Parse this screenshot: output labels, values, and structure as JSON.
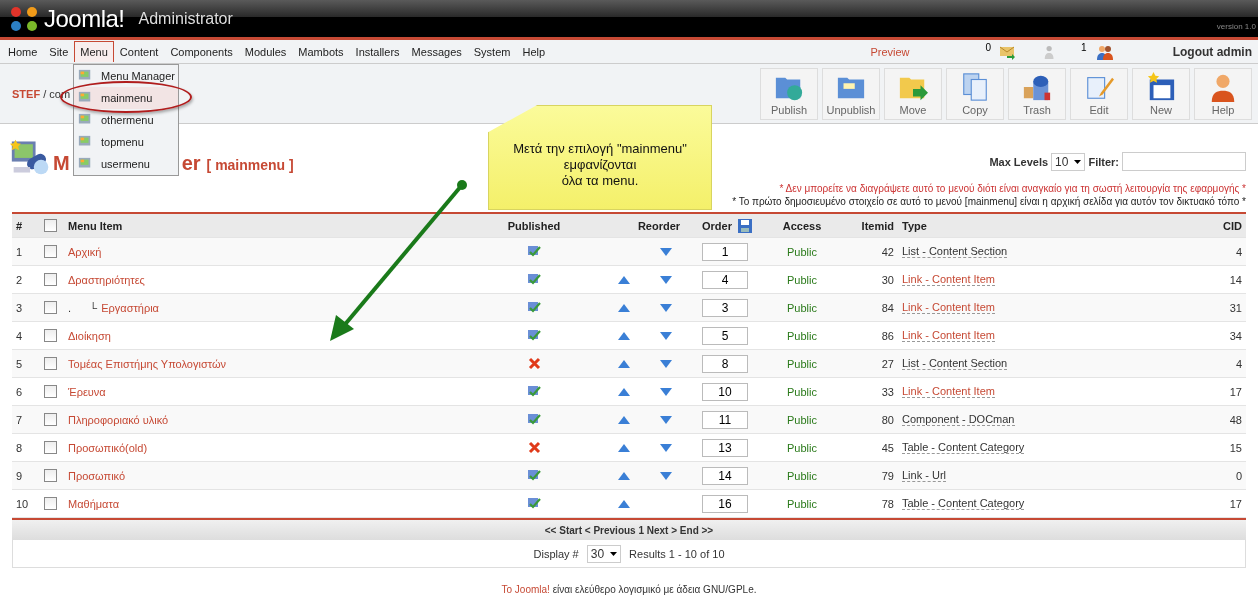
{
  "header": {
    "logo_text": "Joomla!",
    "subtitle": "Administrator",
    "version": "version 1.0"
  },
  "nav": {
    "items": [
      {
        "label": "Home",
        "selected": false
      },
      {
        "label": "Site",
        "selected": false
      },
      {
        "label": "Menu",
        "selected": true
      },
      {
        "label": "Content",
        "selected": false
      },
      {
        "label": "Components",
        "selected": false
      },
      {
        "label": "Modules",
        "selected": false
      },
      {
        "label": "Mambots",
        "selected": false
      },
      {
        "label": "Installers",
        "selected": false
      },
      {
        "label": "Messages",
        "selected": false
      },
      {
        "label": "System",
        "selected": false
      },
      {
        "label": "Help",
        "selected": false
      }
    ],
    "preview": "Preview",
    "messages_count": "0",
    "online_count": "1",
    "logout": "Logout admin"
  },
  "dropdown": {
    "items": [
      {
        "label": "Menu Manager",
        "selected": false
      },
      {
        "label": "mainmenu",
        "selected": true
      },
      {
        "label": "othermenu",
        "selected": false
      },
      {
        "label": "topmenu",
        "selected": false
      },
      {
        "label": "usermenu",
        "selected": false
      }
    ]
  },
  "breadcrumb": {
    "site": "STEF",
    "path": "/ com"
  },
  "toolbar": {
    "buttons": [
      {
        "label": "Publish",
        "kind": "publish"
      },
      {
        "label": "Unpublish",
        "kind": "unpublish"
      },
      {
        "label": "Move",
        "kind": "move"
      },
      {
        "label": "Copy",
        "kind": "copy"
      },
      {
        "label": "Trash",
        "kind": "trash"
      },
      {
        "label": "Edit",
        "kind": "edit"
      },
      {
        "label": "New",
        "kind": "new"
      },
      {
        "label": "Help",
        "kind": "help"
      }
    ]
  },
  "callout": {
    "lines": [
      "Μετά την επιλογή \"mainmenu\"",
      "εμφανίζονται",
      "όλα τα menu."
    ]
  },
  "page_title": {
    "start": "M",
    "end": "er",
    "menu_name": "[ mainmenu ]"
  },
  "filter": {
    "max_levels_label": "Max Levels",
    "max_levels": "10",
    "filter_label": "Filter:"
  },
  "notices": [
    {
      "text": "* Δεν μπορείτε να διαγράψετε αυτό το μενού διότι είναι αναγκαίο για τη σωστή λειτουργία της εφαρμογής *",
      "kind": "warning"
    },
    {
      "text": "* Το πρώτο δημοσιευμένο στοιχείο σε αυτό το μενού [mainmenu] είναι η αρχική σελίδα για αυτόν τον δικτυακό τόπο *",
      "kind": "info"
    }
  ],
  "table": {
    "select_all_checked": false,
    "columns": [
      "#",
      "Menu Item",
      "Published",
      "Reorder",
      "Order",
      "Access",
      "Itemid",
      "Type",
      "CID"
    ],
    "rows": [
      {
        "num": "1",
        "name": "Αρχική",
        "checked": false,
        "published": true,
        "can_up": false,
        "can_down": true,
        "order": "1",
        "access": "Public",
        "itemid": "42",
        "type": "List - Content Section",
        "type_link": false,
        "cid": "4"
      },
      {
        "num": "2",
        "name": "Δραστηριότητες",
        "checked": false,
        "published": true,
        "can_up": true,
        "can_down": true,
        "order": "4",
        "access": "Public",
        "itemid": "30",
        "type": "Link - Content Item",
        "type_link": true,
        "cid": "14",
        "children": [
          {
            "num": "3",
            "prefix": ".      └",
            "name": "Εργαστήρια",
            "checked": false,
            "published": true,
            "can_up": true,
            "can_down": true,
            "order": "3",
            "access": "Public",
            "itemid": "84",
            "type": "Link - Content Item",
            "type_link": true,
            "cid": "31"
          }
        ]
      },
      {
        "num": "4",
        "name": "Διοίκηση",
        "checked": false,
        "published": true,
        "can_up": true,
        "can_down": true,
        "order": "5",
        "access": "Public",
        "itemid": "86",
        "type": "Link - Content Item",
        "type_link": true,
        "cid": "34"
      },
      {
        "num": "5",
        "name": "Τομέας Επιστήμης Υπολογιστών",
        "checked": false,
        "published": false,
        "can_up": true,
        "can_down": true,
        "order": "8",
        "access": "Public",
        "itemid": "27",
        "type": "List - Content Section",
        "type_link": false,
        "cid": "4"
      },
      {
        "num": "6",
        "name": "Έρευνα",
        "checked": false,
        "published": true,
        "can_up": true,
        "can_down": true,
        "order": "10",
        "access": "Public",
        "itemid": "33",
        "type": "Link - Content Item",
        "type_link": true,
        "cid": "17"
      },
      {
        "num": "7",
        "name": "Πληροφοριακό υλικό",
        "checked": false,
        "published": true,
        "can_up": true,
        "can_down": true,
        "order": "11",
        "access": "Public",
        "itemid": "80",
        "type": "Component - DOCman",
        "type_link": false,
        "cid": "48"
      },
      {
        "num": "8",
        "name": "Προσωπικό(old)",
        "checked": false,
        "published": false,
        "can_up": true,
        "can_down": true,
        "order": "13",
        "access": "Public",
        "itemid": "45",
        "type": "Table - Content Category",
        "type_link": false,
        "cid": "15"
      },
      {
        "num": "9",
        "name": "Προσωπικό",
        "checked": false,
        "published": true,
        "can_up": true,
        "can_down": true,
        "order": "14",
        "access": "Public",
        "itemid": "79",
        "type": "Link - Url",
        "type_link": false,
        "cid": "0"
      },
      {
        "num": "10",
        "name": "Μαθήματα",
        "checked": false,
        "published": true,
        "can_up": true,
        "can_down": false,
        "order": "16",
        "access": "Public",
        "itemid": "78",
        "type": "Table - Content Category",
        "type_link": false,
        "cid": "17"
      }
    ]
  },
  "pagination": {
    "text": "<< Start < Previous 1 Next > End >>",
    "display_label": "Display #",
    "display_value": "30",
    "results": "Results 1 - 10 of 10"
  },
  "footer": {
    "link": "To Joomla!",
    "text": "είναι ελεύθερο λογισμικό με άδεια GNU/GPLe."
  }
}
